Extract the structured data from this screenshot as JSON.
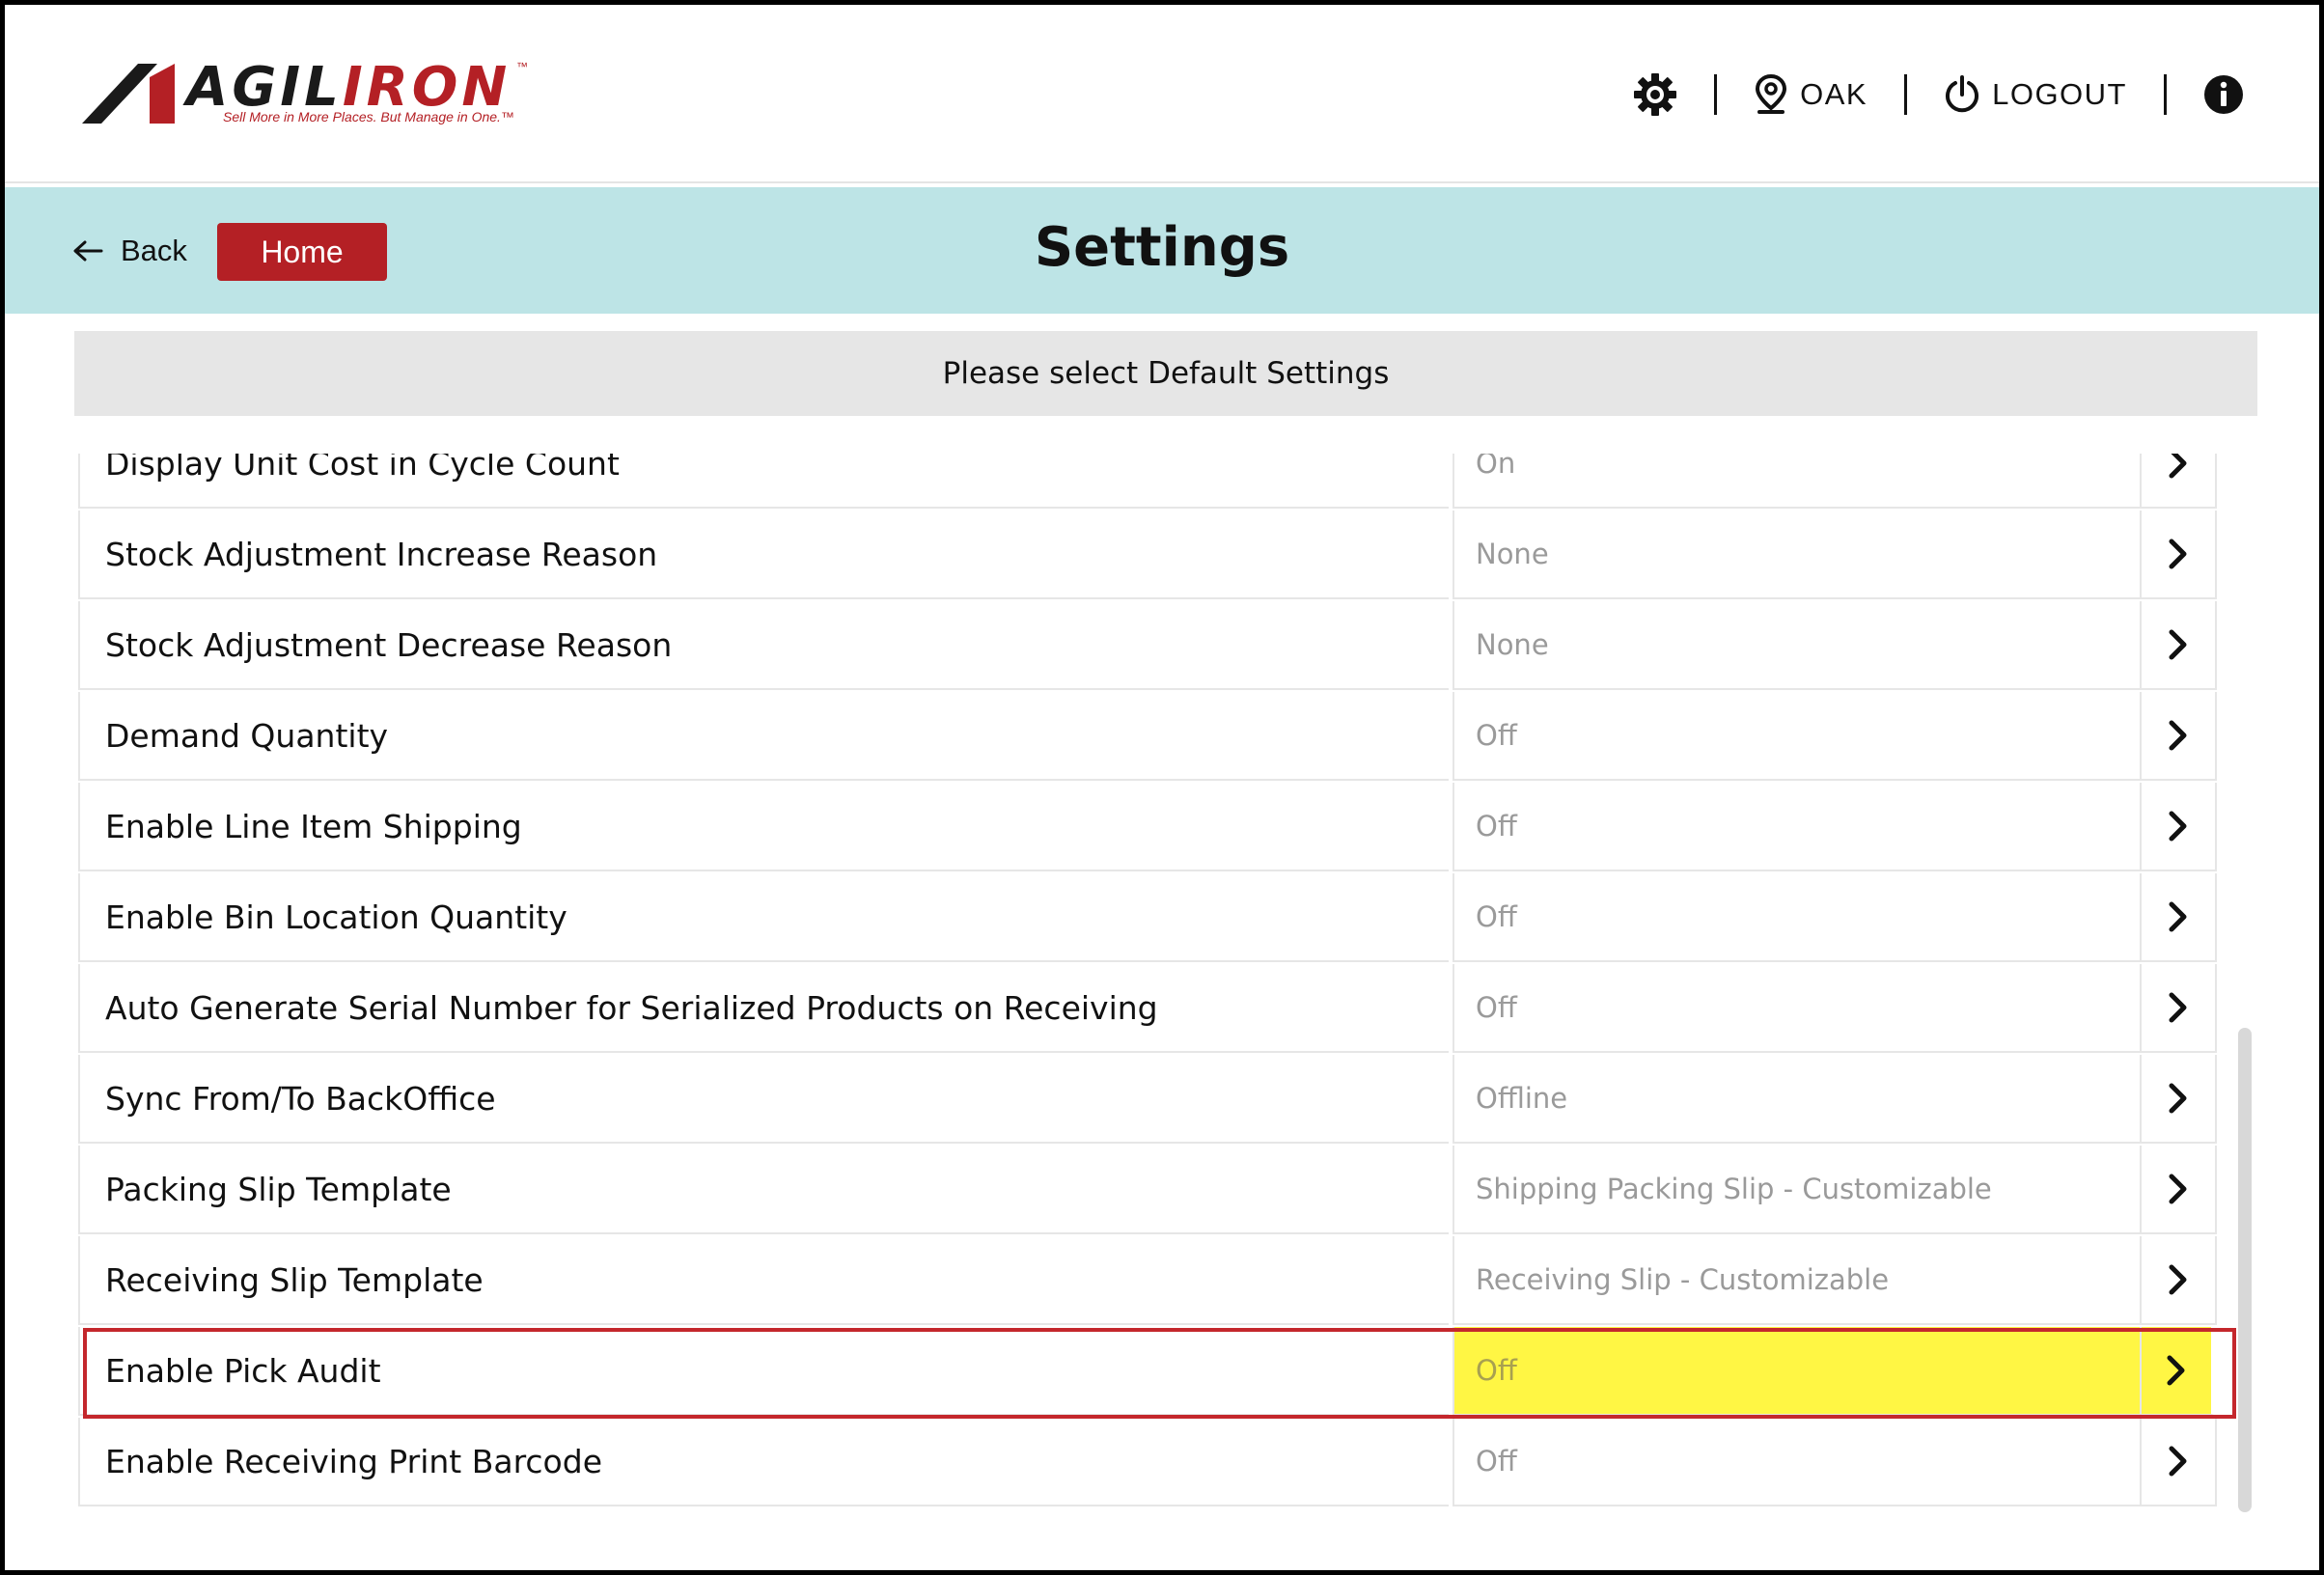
{
  "header": {
    "logo": {
      "text_dark": "AGIL",
      "text_red": "IRON",
      "tm": "™",
      "tagline": "Sell More in More Places. But Manage in One.™"
    },
    "location_label": "OAK",
    "logout_label": "LOGOUT",
    "icons": [
      "gear-icon",
      "location-pin-icon",
      "power-icon",
      "info-icon"
    ]
  },
  "titlebar": {
    "back_label": "Back",
    "home_label": "Home",
    "title": "Settings"
  },
  "subheader": {
    "text": "Please select Default Settings"
  },
  "settings": [
    {
      "label": "Display Unit Cost in Cycle Count",
      "value": "On"
    },
    {
      "label": "Stock Adjustment Increase Reason",
      "value": "None"
    },
    {
      "label": "Stock Adjustment Decrease Reason",
      "value": "None"
    },
    {
      "label": "Demand Quantity",
      "value": "Off"
    },
    {
      "label": "Enable Line Item Shipping",
      "value": "Off"
    },
    {
      "label": "Enable Bin Location Quantity",
      "value": "Off"
    },
    {
      "label": "Auto Generate Serial Number for Serialized Products on Receiving",
      "value": "Off"
    },
    {
      "label": "Sync From/To BackOffice",
      "value": "Offline"
    },
    {
      "label": "Packing Slip Template",
      "value": "Shipping Packing Slip - Customizable"
    },
    {
      "label": "Receiving Slip Template",
      "value": "Receiving Slip - Customizable"
    },
    {
      "label": "Enable Pick Audit",
      "value": "Off",
      "highlighted": true
    },
    {
      "label": "Enable Receiving Print Barcode",
      "value": "Off"
    }
  ],
  "colors": {
    "brand_red": "#b42025",
    "titlebar_bg": "#bde4e6",
    "highlight_yellow": "#fff644",
    "highlight_border": "#c4272c"
  }
}
